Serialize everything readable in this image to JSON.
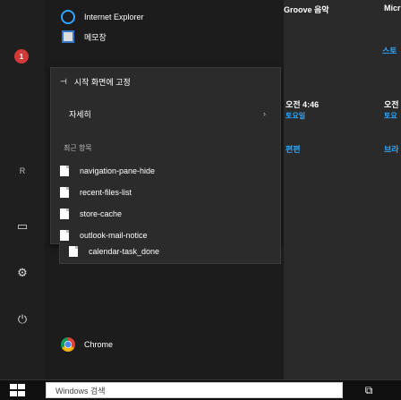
{
  "top_apps": [
    {
      "label": "Internet Explorer",
      "icon": "ie-icon"
    },
    {
      "label": "메모장",
      "icon": "app-icon"
    }
  ],
  "badge": {
    "value": "1"
  },
  "context_menu": {
    "pin_label": "시작 화면에 고정",
    "more_label": "자세히",
    "more_chevron": "›",
    "recent_header": "최근 항목",
    "recent": [
      {
        "label": "navigation-pane-hide"
      },
      {
        "label": "recent-files-list"
      },
      {
        "label": "store-cache"
      },
      {
        "label": "outlook-mail-notice"
      },
      {
        "label": "calendar-task_done"
      }
    ]
  },
  "bottom_app": {
    "label": "Chrome",
    "icon": "chrome-icon"
  },
  "tiles": {
    "groove": "Groove 음악",
    "micro": "Micr",
    "t1": "스토",
    "time": "오전 4:46",
    "t2": "오전",
    "t3": "토요일",
    "t4": "토요",
    "t5": "편편",
    "t6": "브라"
  },
  "rail": {
    "user_initial": "R",
    "icons": [
      "user-icon",
      "document-icon",
      "settings-icon",
      "power-icon"
    ]
  },
  "taskbar": {
    "search_placeholder": "Windows 검색",
    "taskview_glyph": "⧉"
  }
}
